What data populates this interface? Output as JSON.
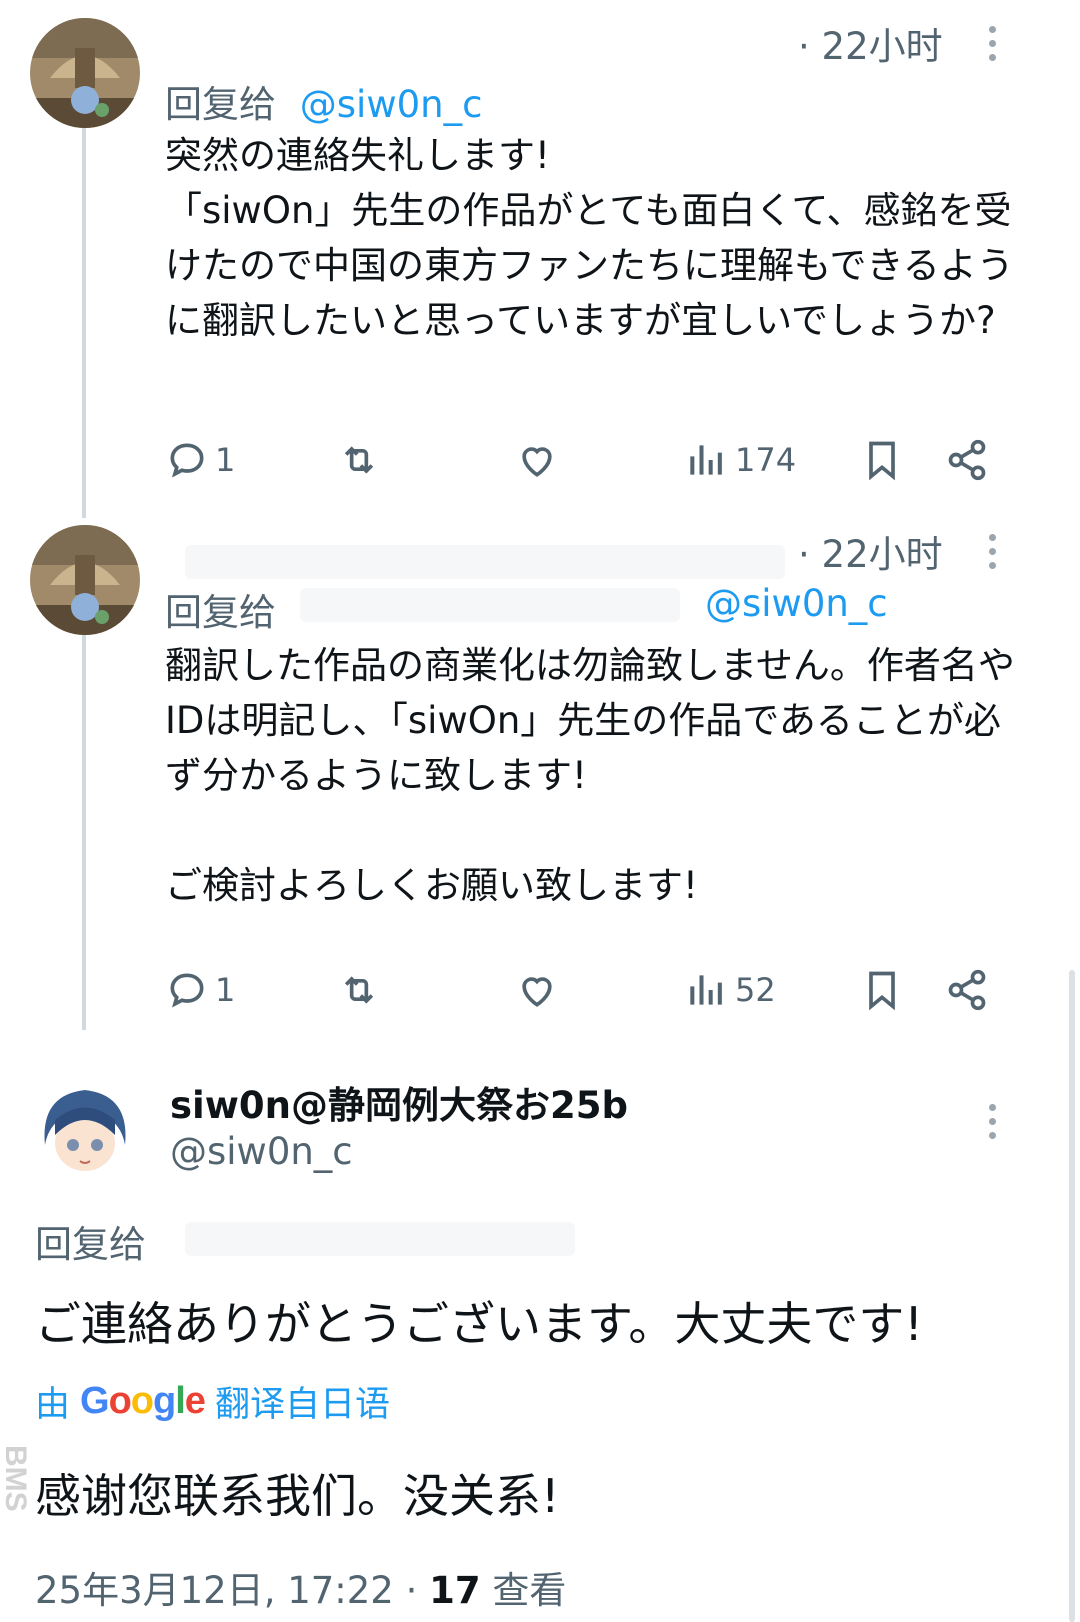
{
  "tweet1": {
    "time": "· 22小时",
    "reply_prefix": "回复给",
    "reply_handle": "@siw0n_c",
    "text": "突然の連絡失礼します!\n「siwOn」先生の作品がとても面白くて、感銘を受けたので中国の東方ファンたちに理解もできるように翻訳したいと思っていますが宜しいでしょうか?",
    "replies": "1",
    "views": "174"
  },
  "tweet2": {
    "time": "· 22小时",
    "reply_prefix": "回复给",
    "reply_handle": "@siw0n_c",
    "text": "翻訳した作品の商業化は勿論致しません。作者名やIDは明記し、「siwOn」先生の作品であることが必ず分かるように致します!\n\nご検討よろしくお願い致します!",
    "replies": "1",
    "views": "52"
  },
  "main": {
    "display_name": "siw0n@静岡例大祭お25b",
    "handle": "@siw0n_c",
    "reply_prefix": "回复给",
    "text": "ご連絡ありがとうございます。大丈夫です!",
    "translate_prefix": "由",
    "translate_brand": "Google",
    "translate_suffix": "翻译自日语",
    "translated_text": "感谢您联系我们。没关系!",
    "date": "25年3月12日, 17:22 ·",
    "views_count": "17",
    "views_label": "查看"
  },
  "watermark": "BMS",
  "colors": {
    "accent": "#1d9bf0",
    "secondary_text": "#536471",
    "thread_line": "#cfd9de"
  },
  "icons": [
    "reply-icon",
    "retweet-icon",
    "like-icon",
    "views-icon",
    "bookmark-icon",
    "share-icon",
    "more-icon"
  ]
}
